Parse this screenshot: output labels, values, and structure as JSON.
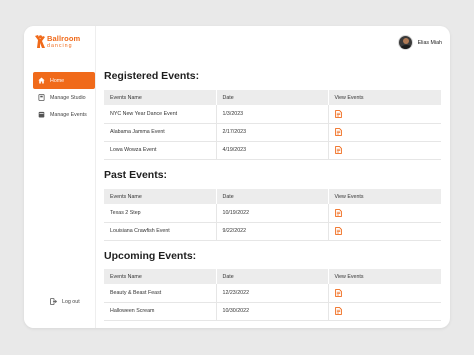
{
  "brand": {
    "name_line1": "Ballroom",
    "name_line2": "dancing",
    "accent": "#f06a1a"
  },
  "sidebar": {
    "items": [
      {
        "label": "Home",
        "icon": "home-icon",
        "active": true
      },
      {
        "label": "Manage Studio",
        "icon": "studio-icon",
        "active": false
      },
      {
        "label": "Manage Events",
        "icon": "events-icon",
        "active": false
      }
    ],
    "logout_label": "Log out",
    "logout_icon": "logout-icon"
  },
  "user": {
    "name": "Elias Miah"
  },
  "registered": {
    "title": "Registered Events:",
    "columns": [
      "Events Name",
      "Date",
      "View Events"
    ],
    "rows": [
      {
        "name": "NYC New Year Dance Event",
        "date": "1/3/2023"
      },
      {
        "name": "Alabama Jamma Event",
        "date": "2/17/2023"
      },
      {
        "name": "Lowa Wowza Event",
        "date": "4/19/2023"
      }
    ]
  },
  "past": {
    "title": "Past Events:",
    "columns": [
      "Events Name",
      "Date",
      "View Events"
    ],
    "rows": [
      {
        "name": "Texas 2 Step",
        "date": "10/19/2022"
      },
      {
        "name": "Louisiana Crawfish Event",
        "date": "9/22/2022"
      }
    ]
  },
  "upcoming": {
    "title": "Upcoming Events:",
    "columns": [
      "Events Name",
      "Date",
      "View Events"
    ],
    "rows": [
      {
        "name": "Beauty & Beast Feast",
        "date": "12/23/2022"
      },
      {
        "name": "Halloween Scream",
        "date": "10/30/2022"
      }
    ]
  },
  "view_icon": "document-icon"
}
